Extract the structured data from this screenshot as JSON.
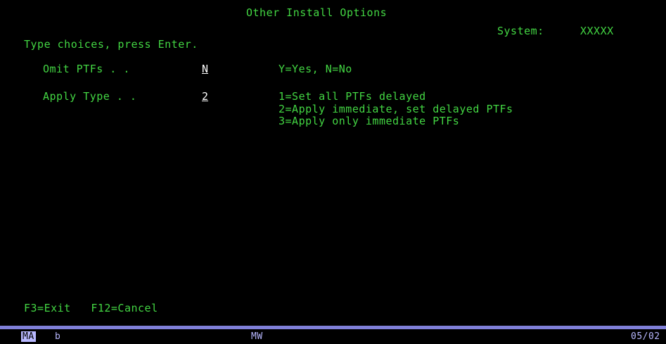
{
  "screen": {
    "title": "Other Install Options",
    "system_label": "System:",
    "system_value": "XXXXX",
    "instructions": "Type choices, press Enter."
  },
  "fields": {
    "omit_ptfs": {
      "label": "Omit PTFs . .",
      "value": "N",
      "help": "Y=Yes, N=No"
    },
    "apply_type": {
      "label": "Apply Type . .",
      "value": "2",
      "help": [
        "1=Set all PTFs delayed",
        "2=Apply immediate, set delayed PTFs",
        "3=Apply only immediate PTFs"
      ]
    }
  },
  "function_keys": {
    "f3": "F3=Exit",
    "f12": "F12=Cancel"
  },
  "oia": {
    "mode": "MA",
    "indicator": "b",
    "input_mode": "MW",
    "cursor_pos": "05/02"
  },
  "colors": {
    "text_green": "#43d643",
    "input_white": "#ffffff",
    "status_bar": "#7f7fd8"
  }
}
